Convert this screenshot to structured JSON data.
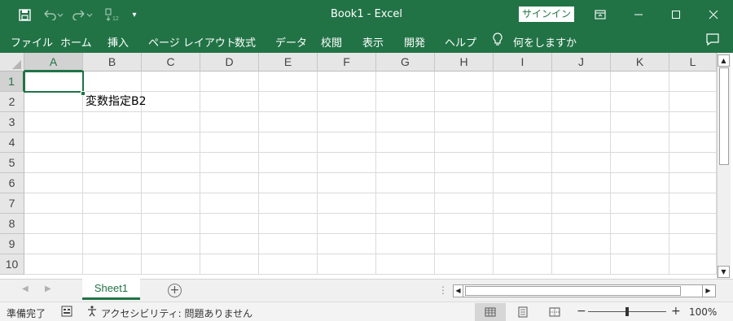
{
  "titlebar": {
    "title": "Book1  -  Excel",
    "signin_label": "サインイン"
  },
  "qat": {
    "save": "save-icon",
    "undo": "undo-icon",
    "redo": "redo-icon",
    "sort": "sort-icon",
    "customize": "customize-icon"
  },
  "ribbon": {
    "tabs": [
      "ファイル",
      "ホーム",
      "挿入",
      "ページ レイアウト",
      "数式",
      "データ",
      "校閲",
      "表示",
      "開発",
      "ヘルプ"
    ],
    "tell_me": "何をしますか"
  },
  "grid": {
    "columns": [
      "A",
      "B",
      "C",
      "D",
      "E",
      "F",
      "G",
      "H",
      "I",
      "J",
      "K",
      "L"
    ],
    "rows": [
      "1",
      "2",
      "3",
      "4",
      "5",
      "6",
      "7",
      "8",
      "9",
      "10"
    ],
    "cells": {
      "B2": "変数指定B2"
    },
    "active_cell": "A1"
  },
  "sheets": {
    "tabs": [
      "Sheet1"
    ],
    "active": "Sheet1"
  },
  "status": {
    "ready": "準備完了",
    "accessibility": "アクセシビリティ: 問題ありません",
    "zoom": "100%",
    "zoom_minus": "−",
    "zoom_plus": "+"
  },
  "colors": {
    "accent": "#217346"
  }
}
